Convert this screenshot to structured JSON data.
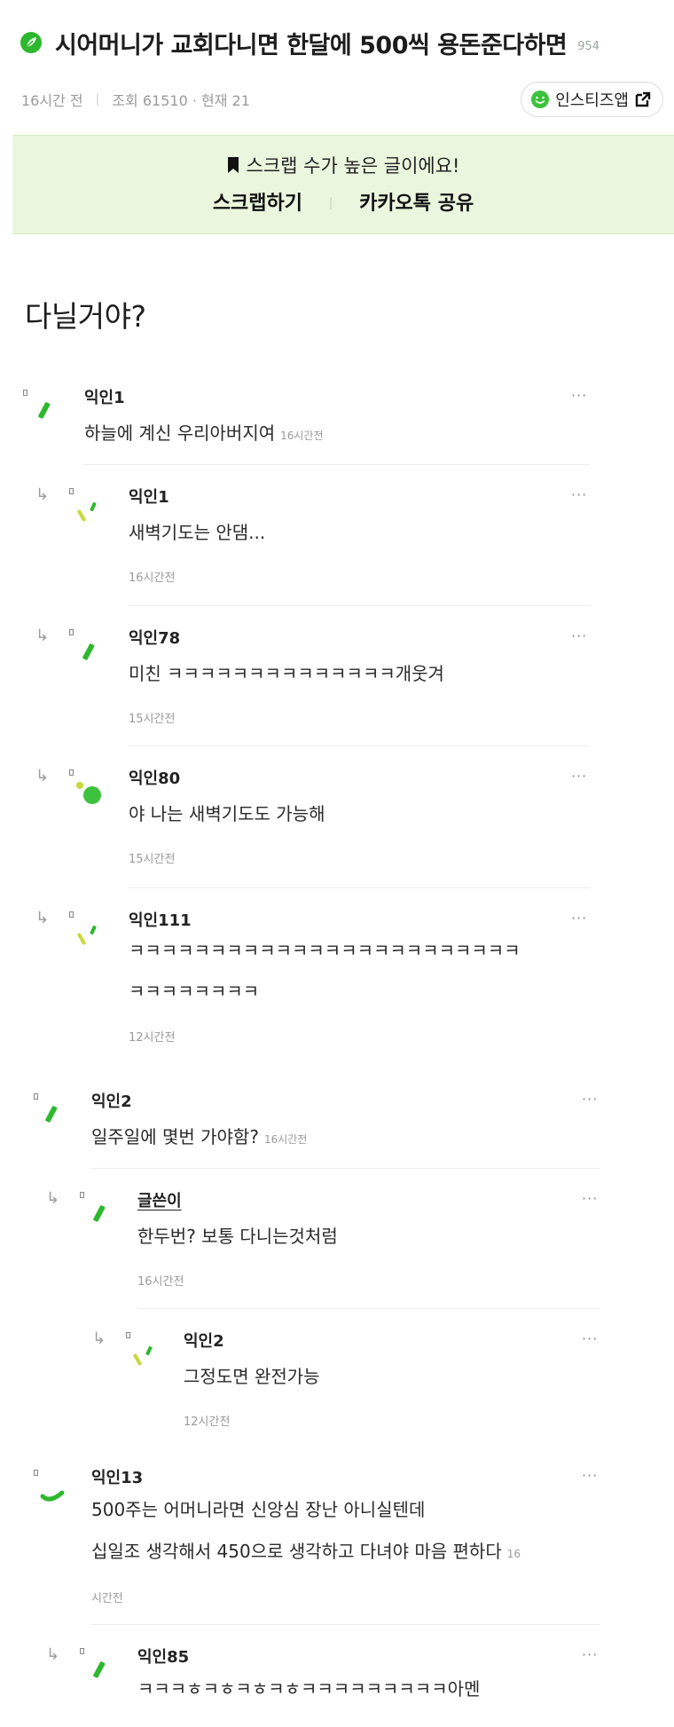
{
  "post": {
    "title": "시어머니가 교회다니면 한달에 500씩 용돈준다하면",
    "count": "954",
    "time": "16시간 전",
    "views": "조회 61510 · 현재 21",
    "insta_label": "인스티즈앱",
    "scrap_notice": "스크랩 수가 높은 글이에요!",
    "scrap_button": "스크랩하기",
    "kakao_button": "카카오톡 공유",
    "body": "다닐거야?"
  },
  "comments": [
    {
      "author": "익인1",
      "text": "하늘에 계신 우리아버지여",
      "time": "16시간전"
    },
    {
      "author": "익인1",
      "text": "새벽기도는 안댐...",
      "time": "16시간전"
    },
    {
      "author": "익인78",
      "text": "미친 ㅋㅋㅋㅋㅋㅋㅋㅋㅋㅋㅋㅋㅋㅋ개웃겨",
      "time": "15시간전"
    },
    {
      "author": "익인80",
      "text": "야 나는 새벽기도도 가능해",
      "time": "15시간전"
    },
    {
      "author": "익인111",
      "text_line1": "ㅋㅋㅋㅋㅋㅋㅋㅋㅋㅋㅋㅋㅋㅋㅋㅋㅋㅋㅋㅋㅋㅋㅋㅋ",
      "text_line2": "ㅋㅋㅋㅋㅋㅋㅋㅋ",
      "time": "12시간전"
    },
    {
      "author": "익인2",
      "text": "일주일에 몇번 가야함?",
      "time": "16시간전"
    },
    {
      "author": "글쓴이",
      "text": "한두번? 보통 다니는것처럼",
      "time": "16시간전"
    },
    {
      "author": "익인2",
      "text": "그정도면 완전가능",
      "time": "12시간전"
    },
    {
      "author": "익인13",
      "text_line1": "500주는 어머니라면 신앙심 장난 아니실텐데",
      "text_line2": "십일조 생각해서 450으로 생각하고 다녀야 마음 편하다",
      "time_part1": "16",
      "time_part2": "시간전"
    },
    {
      "author": "익인85",
      "text": "ㅋㅋㅋㅎㅋㅎㅋㅎㅋㅎㅋㅋㅋㅋㅋㅋㅋㅋㅋ아멘"
    }
  ],
  "ui": {
    "more": "···",
    "reply_arrow": "↳"
  },
  "colors": {
    "accent_green": "#2eb82e",
    "scrap_bg": "#eaf7de"
  }
}
